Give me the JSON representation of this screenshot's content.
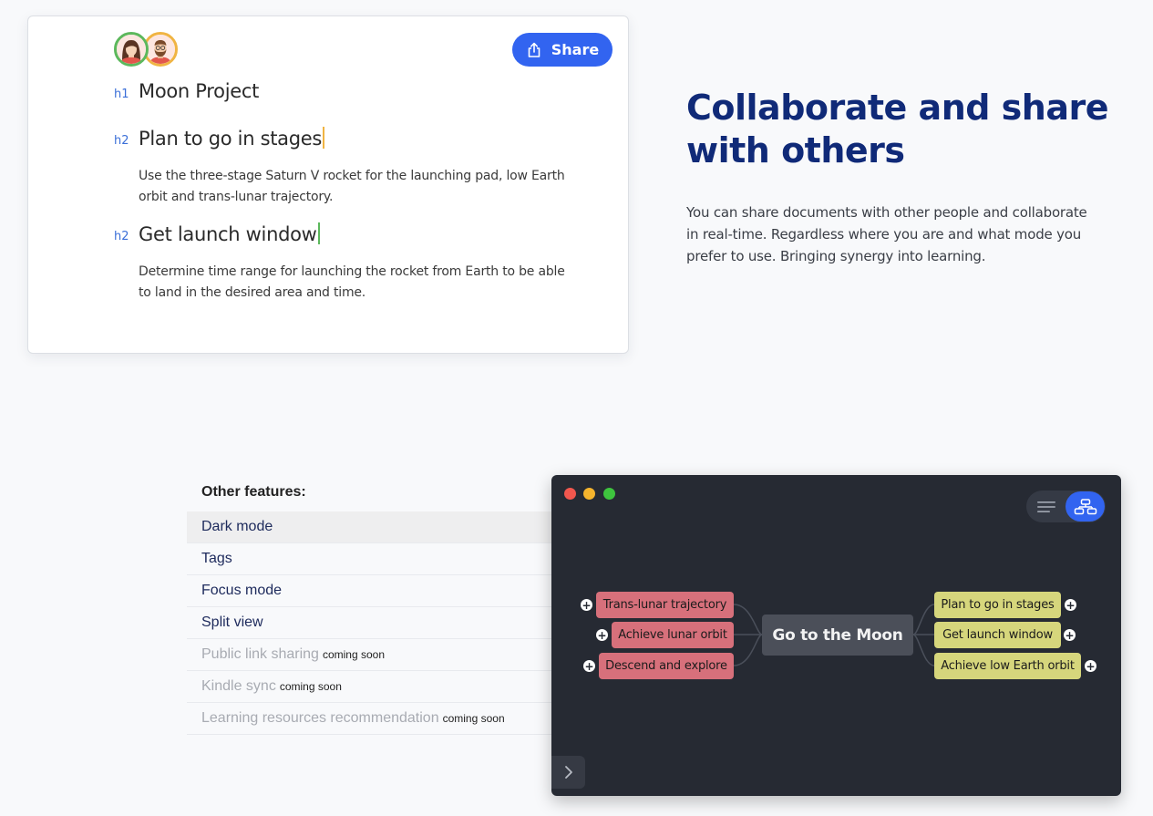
{
  "document": {
    "share_label": "Share",
    "heading1": {
      "tag": "h1",
      "text": "Moon Project"
    },
    "sections": [
      {
        "tag": "h2",
        "heading": "Plan to go in stages",
        "body": "Use the three-stage Saturn V rocket for the launching pad, low Earth orbit and trans-lunar trajectory."
      },
      {
        "tag": "h2",
        "heading": "Get launch window",
        "body": "Determine time range for launching the rocket from Earth to be able to land in the desired area and time."
      }
    ]
  },
  "hero": {
    "title": "Collaborate and share with others",
    "description": "You can share documents with other people and collaborate in real-time. Regardless where you are and what mode you prefer to use. Bringing synergy into learning."
  },
  "features": {
    "title": "Other features:",
    "items": [
      {
        "label": "Dark mode",
        "tag": ""
      },
      {
        "label": "Tags",
        "tag": ""
      },
      {
        "label": "Focus mode",
        "tag": ""
      },
      {
        "label": "Split view",
        "tag": ""
      },
      {
        "label": "Public link sharing",
        "tag": "coming soon"
      },
      {
        "label": "Kindle sync",
        "tag": "coming soon"
      },
      {
        "label": "Learning resources recommendation",
        "tag": "coming soon"
      }
    ]
  },
  "mindmap": {
    "center": "Go to the Moon",
    "left_nodes": [
      "Trans-lunar trajectory",
      "Achieve lunar orbit",
      "Descend and explore"
    ],
    "right_nodes": [
      "Plan to go in stages",
      "Get launch window",
      "Achieve low Earth orbit"
    ],
    "plus_glyph": "+"
  },
  "colors": {
    "accent": "#3264f0",
    "heading_navy": "#102a78",
    "mindmap_bg": "#262a33",
    "node_left": "#d7707b",
    "node_right": "#d6d67c",
    "cursor_yellow": "#f0b442",
    "cursor_green": "#5cb85c"
  },
  "icons": {
    "share": "share-upload-icon",
    "list_view": "list-view-icon",
    "mindmap_view": "mindmap-view-icon",
    "expand": "chevron-right-icon",
    "avatars": [
      "avatar-woman",
      "avatar-man"
    ]
  }
}
